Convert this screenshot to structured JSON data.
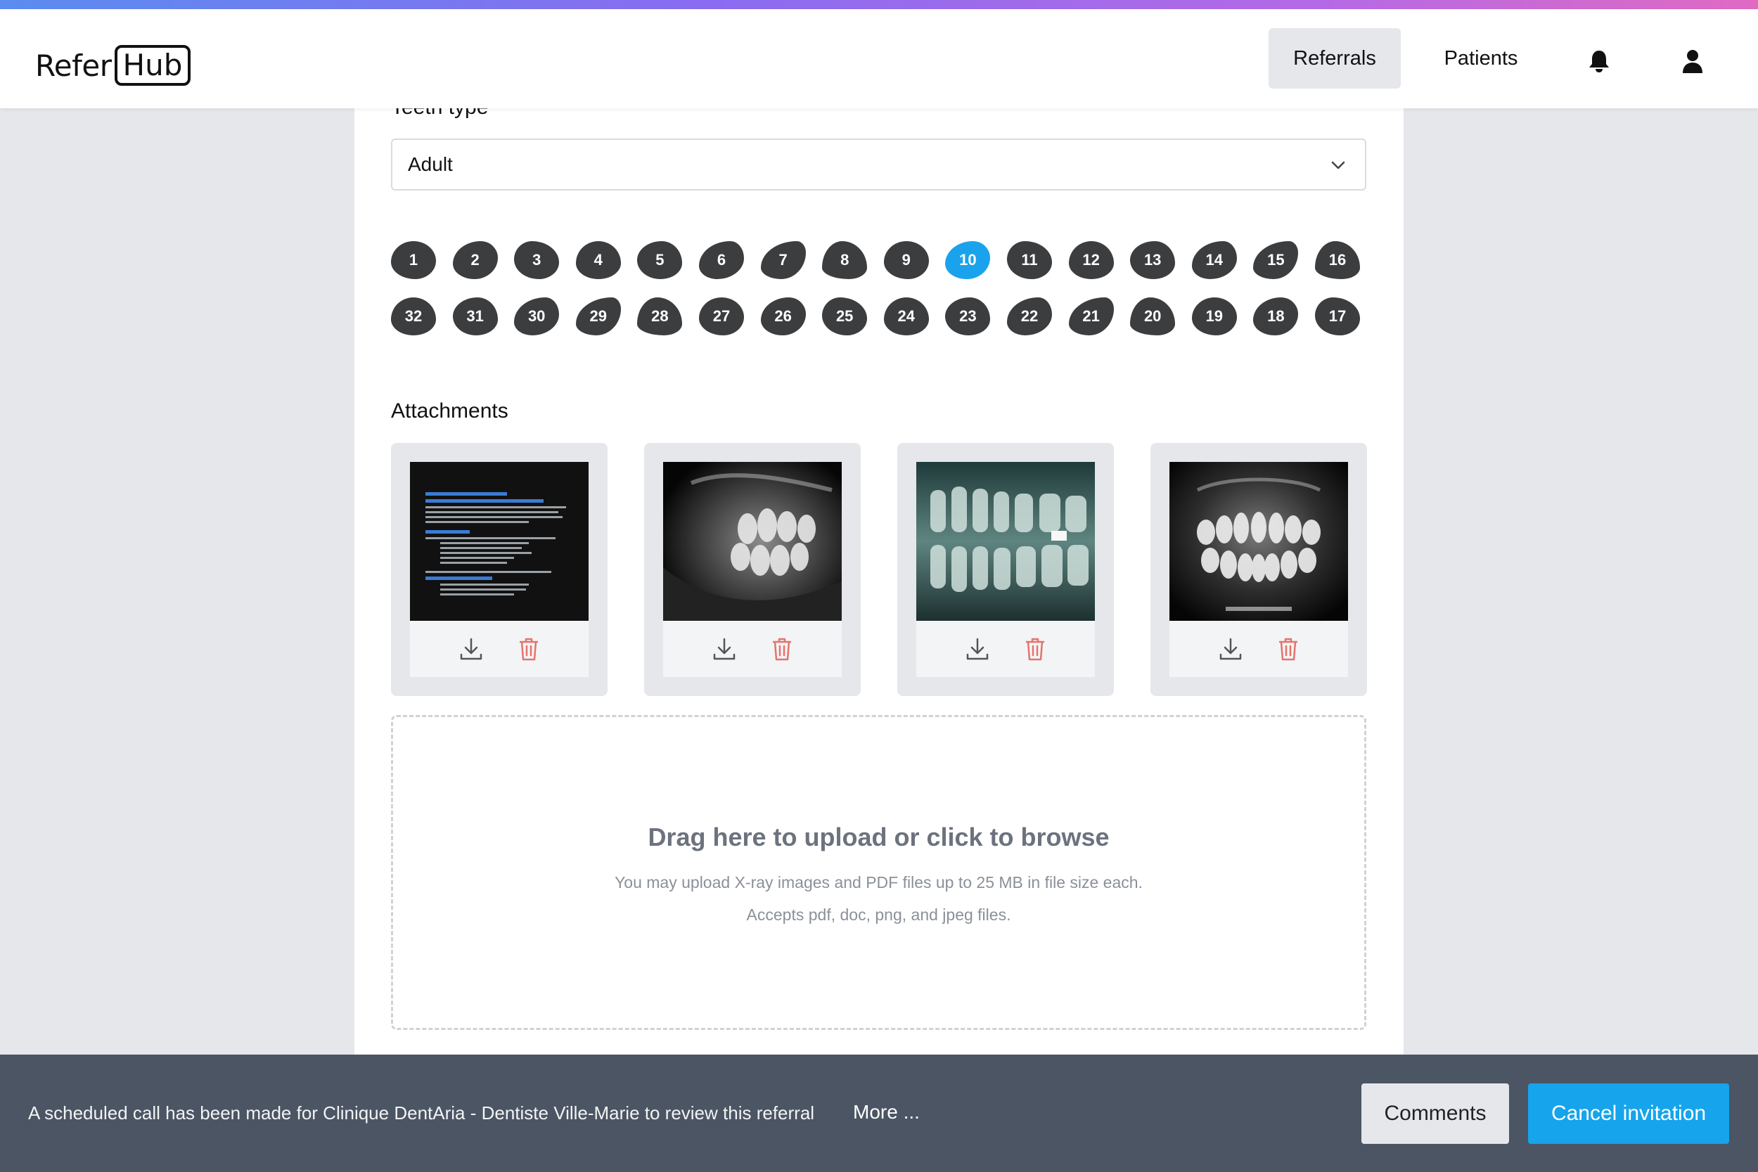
{
  "header": {
    "logo_left": "Refer",
    "logo_right": "Hub",
    "nav": [
      {
        "label": "Referrals",
        "active": true
      },
      {
        "label": "Patients",
        "active": false
      }
    ],
    "icons": {
      "notifications": "bell-icon",
      "account": "user-icon"
    }
  },
  "form": {
    "teeth_type_label": "Teeth type",
    "teeth_type_value": "Adult",
    "selected_tooth": "10",
    "upper_teeth": [
      "1",
      "2",
      "3",
      "4",
      "5",
      "6",
      "7",
      "8",
      "9",
      "10",
      "11",
      "12",
      "13",
      "14",
      "15",
      "16"
    ],
    "lower_teeth": [
      "32",
      "31",
      "30",
      "29",
      "28",
      "27",
      "26",
      "25",
      "24",
      "23",
      "22",
      "21",
      "20",
      "19",
      "18",
      "17"
    ]
  },
  "attachments": {
    "title": "Attachments",
    "items": [
      {
        "kind": "pdf-document",
        "doc_title": "Referral Template for Primary Care Referrals to Dentistry"
      },
      {
        "kind": "x-ray-image"
      },
      {
        "kind": "x-ray-image"
      },
      {
        "kind": "x-ray-image"
      }
    ],
    "action_icons": {
      "download": "download-icon",
      "delete": "trash-icon"
    }
  },
  "dropzone": {
    "title": "Drag here to upload or click to browse",
    "line1": "You may upload X-ray images and PDF files up to 25 MB in file size each.",
    "line2": "Accepts pdf, doc, png, and jpeg files."
  },
  "footer": {
    "message": "A scheduled call has been made for Clinique DentAria - Dentiste Ville-Marie to review this referral",
    "more": "More ...",
    "comments_label": "Comments",
    "cancel_label": "Cancel invitation"
  },
  "colors": {
    "accent": "#16a4ec",
    "tooth": "#3c3d3f",
    "delete": "#e5736b",
    "footer_bg": "#4b5563"
  }
}
